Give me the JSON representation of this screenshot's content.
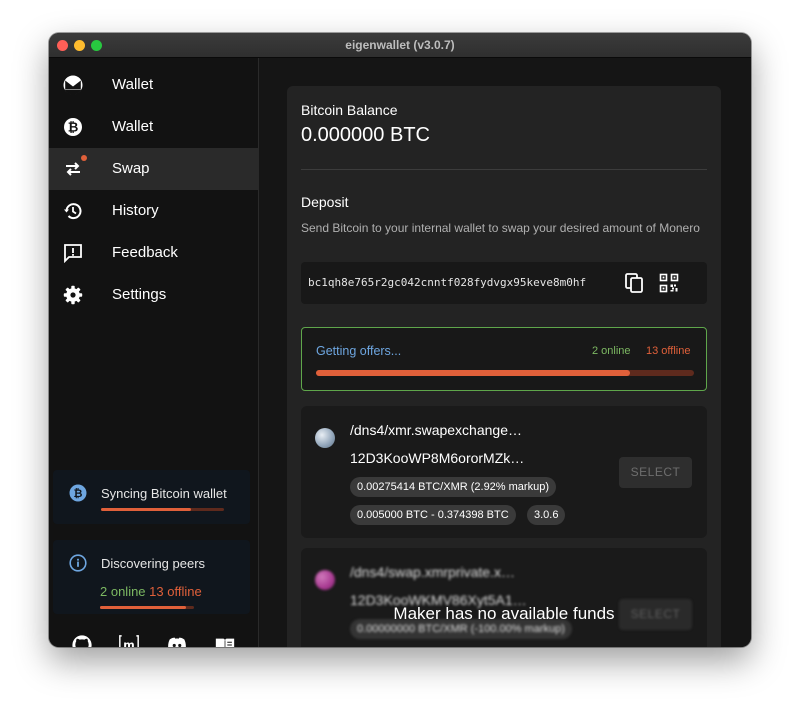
{
  "window": {
    "title": "eigenwallet (v3.0.7)"
  },
  "sidebar": {
    "items": [
      {
        "label": "Wallet",
        "icon": "monero-icon"
      },
      {
        "label": "Wallet",
        "icon": "bitcoin-icon"
      },
      {
        "label": "Swap",
        "icon": "swap-icon",
        "active": true,
        "badge": true
      },
      {
        "label": "History",
        "icon": "history-icon"
      },
      {
        "label": "Feedback",
        "icon": "feedback-icon"
      },
      {
        "label": "Settings",
        "icon": "settings-icon"
      }
    ],
    "sync": {
      "text": "Syncing Bitcoin wallet",
      "progress": 0.73
    },
    "peers": {
      "text": "Discovering peers",
      "online": "2 online",
      "offline": "13 offline",
      "progress": 0.92
    },
    "social": [
      "github-icon",
      "matrix-icon",
      "discord-icon",
      "docs-book-icon"
    ]
  },
  "balance": {
    "label": "Bitcoin Balance",
    "value": "0.000000 BTC"
  },
  "deposit": {
    "label": "Deposit",
    "description": "Send Bitcoin to your internal wallet to swap your desired amount of Monero",
    "address": "bc1qh8e765r2gc042cnntf028fydvgx95keve8m0hf"
  },
  "offers": {
    "label": "Getting offers...",
    "online": "2 online",
    "offline": "13 offline",
    "progress": 0.83
  },
  "makers": [
    {
      "address": "/dns4/xmr.swapexchange…",
      "peer_id": "12D3KooWP8M6ororMZk…",
      "rate": "0.00275414 BTC/XMR (2.92% markup)",
      "range": "0.005000 BTC - 0.374398 BTC",
      "version": "3.0.6",
      "button": "SELECT"
    },
    {
      "address": "/dns4/swap.xmrprivate.x…",
      "peer_id": "12D3KooWKMV86Xyt5A1…",
      "rate": "0.00000000 BTC/XMR (-100.00% markup)",
      "button": "SELECT",
      "overlay": "Maker has no available funds"
    }
  ],
  "colors": {
    "accent": "#e0603a",
    "online": "#7cb862",
    "info": "#6ea6e0"
  }
}
